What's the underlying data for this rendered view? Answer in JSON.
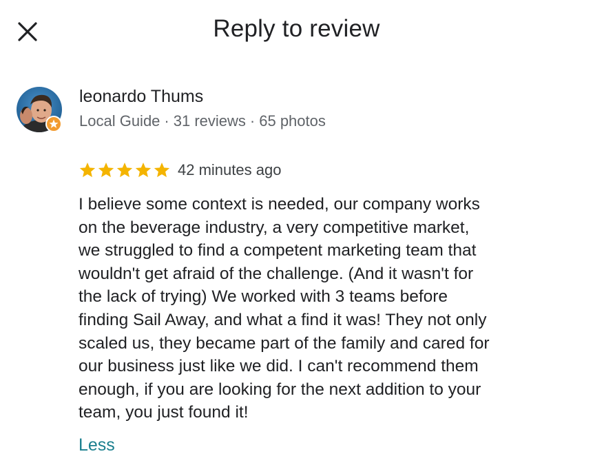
{
  "header": {
    "title": "Reply to review",
    "close_icon": "close-icon"
  },
  "reviewer": {
    "name": "leonardo Thums",
    "badge": "Local Guide",
    "separator": "·",
    "reviews": "31 reviews",
    "photos": "65 photos",
    "avatar_icon": "avatar",
    "local_guide_star_icon": "local-guide-star-icon"
  },
  "review": {
    "rating": 5,
    "max_rating": 5,
    "star_color": "#f4b400",
    "time": "42 minutes ago",
    "lines": [
      "I believe some context is needed, our company works",
      "on the beverage industry, a very competitive market,",
      "we struggled to find a competent marketing team that",
      "wouldn't get afraid of the challenge. (And it wasn't for",
      "the lack of trying) We worked with 3 teams before",
      "finding Sail Away, and what a find it was! They not only",
      "scaled us, they became part of the family and cared for",
      "our business just like we did. I can't recommend them",
      "enough, if you are looking for the next addition to your",
      "team, you just found it!"
    ],
    "less_label": "Less",
    "link_color": "#1a7f8e"
  }
}
